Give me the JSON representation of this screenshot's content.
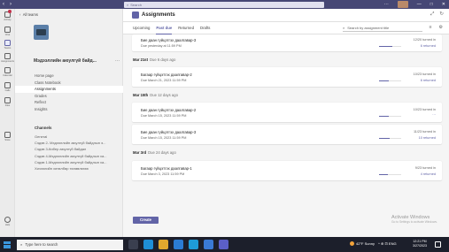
{
  "titlebar": {
    "back": "‹",
    "forward": "›",
    "search_placeholder": "Search",
    "more": "···",
    "minimize": "—",
    "maximize": "□",
    "close": "✕"
  },
  "rail": [
    {
      "label": "Activity",
      "icon": "bell-icon"
    },
    {
      "label": "Chat",
      "icon": "chat-icon"
    },
    {
      "label": "Teams",
      "icon": "teams-icon"
    },
    {
      "label": "Assignments",
      "icon": "assignments-icon"
    },
    {
      "label": "Calendar",
      "icon": "calendar-icon"
    },
    {
      "label": "Calls",
      "icon": "phone-icon"
    },
    {
      "label": "Files",
      "icon": "file-icon"
    },
    {
      "label": "Store",
      "icon": "store-icon"
    },
    {
      "label": "Help",
      "icon": "help-icon"
    }
  ],
  "teampanel": {
    "all_teams": "All teams",
    "team_name": "Мэдээллийн аюулгүй байд...",
    "more": "···",
    "nav": [
      "Home page",
      "Class Notebook",
      "Assignments",
      "Grades",
      "Reflect",
      "Insights"
    ],
    "channels_head": "Channels",
    "channels": [
      "General",
      "Сэдэв 2- Мэдээллийн аюулгүй байдлын э...",
      "Сэдэв 3-Кибер аюулгүй байдал",
      "Сэдэв 4-Мэдээллийн аюулгүй байдлын ха...",
      "Сэдэв 1-Мэдээллийн аюулгүй байдлын ха...",
      "Хичээлийн хөтөлбөр төлөвлөгөө"
    ]
  },
  "header": {
    "title": "Assignments",
    "expand_icon": "⤢",
    "refresh_icon": "↻"
  },
  "tabs": [
    "Upcoming",
    "Past due",
    "Returned",
    "Drafts"
  ],
  "active_tab": "Past due",
  "search_placeholder": "Search by assignment title",
  "filter_icon": "≡",
  "settings_icon": "⚙",
  "groups": [
    {
      "date": "",
      "ago": "",
      "items": [
        {
          "title": "Бие даан гүйцэтгэх даалгавар-3",
          "due": "Due yesterday at 11:59 PM",
          "turned": "12/20 turned in",
          "returned": "6 returned",
          "progress": 0.6
        }
      ]
    },
    {
      "date": "Mar 21st",
      "ago": "Due 6 days ago",
      "items": [
        {
          "title": "Багаар гүйцэтгэх даалгавар-2",
          "due": "Due March 21, 2023 11:59 PM",
          "turned": "10/23 turned in",
          "returned": "6 returned",
          "progress": 0.43
        }
      ]
    },
    {
      "date": "Mar 15th",
      "ago": "Due 12 days ago",
      "items": [
        {
          "title": "Бие даан гүйцэтгэх даалгавар-2",
          "due": "Due March 15, 2023 11:59 PM",
          "turned": "10/23 turned in",
          "returned": "···",
          "progress": 0.43
        },
        {
          "title": "Бие даан гүйцэтгэх даалгавар-3",
          "due": "Due March 15, 2023 11:59 PM",
          "turned": "11/23 turned in",
          "returned": "10 returned",
          "progress": 0.48
        }
      ]
    },
    {
      "date": "Mar 3rd",
      "ago": "Due 24 days ago",
      "items": [
        {
          "title": "Багаар гүйцэтгэх даалгавар-1",
          "due": "Due March 3, 2023 11:59 PM",
          "turned": "9/23 turned in",
          "returned": "4 returned",
          "progress": 0.39
        }
      ]
    }
  ],
  "footer": {
    "create": "Create",
    "watermark_title": "Activate Windows",
    "watermark_sub": "Go to Settings to activate Windows."
  },
  "taskbar": {
    "search": "Type here to search",
    "weather": "42°F Sunny",
    "tray": "^ ⊕ ⊡ ENG",
    "time": "12:21 PM",
    "date": "3/27/2023"
  },
  "colors": {
    "accent": "#6264a7",
    "titlebar": "#464775",
    "taskbar": "#1c1f2b"
  }
}
